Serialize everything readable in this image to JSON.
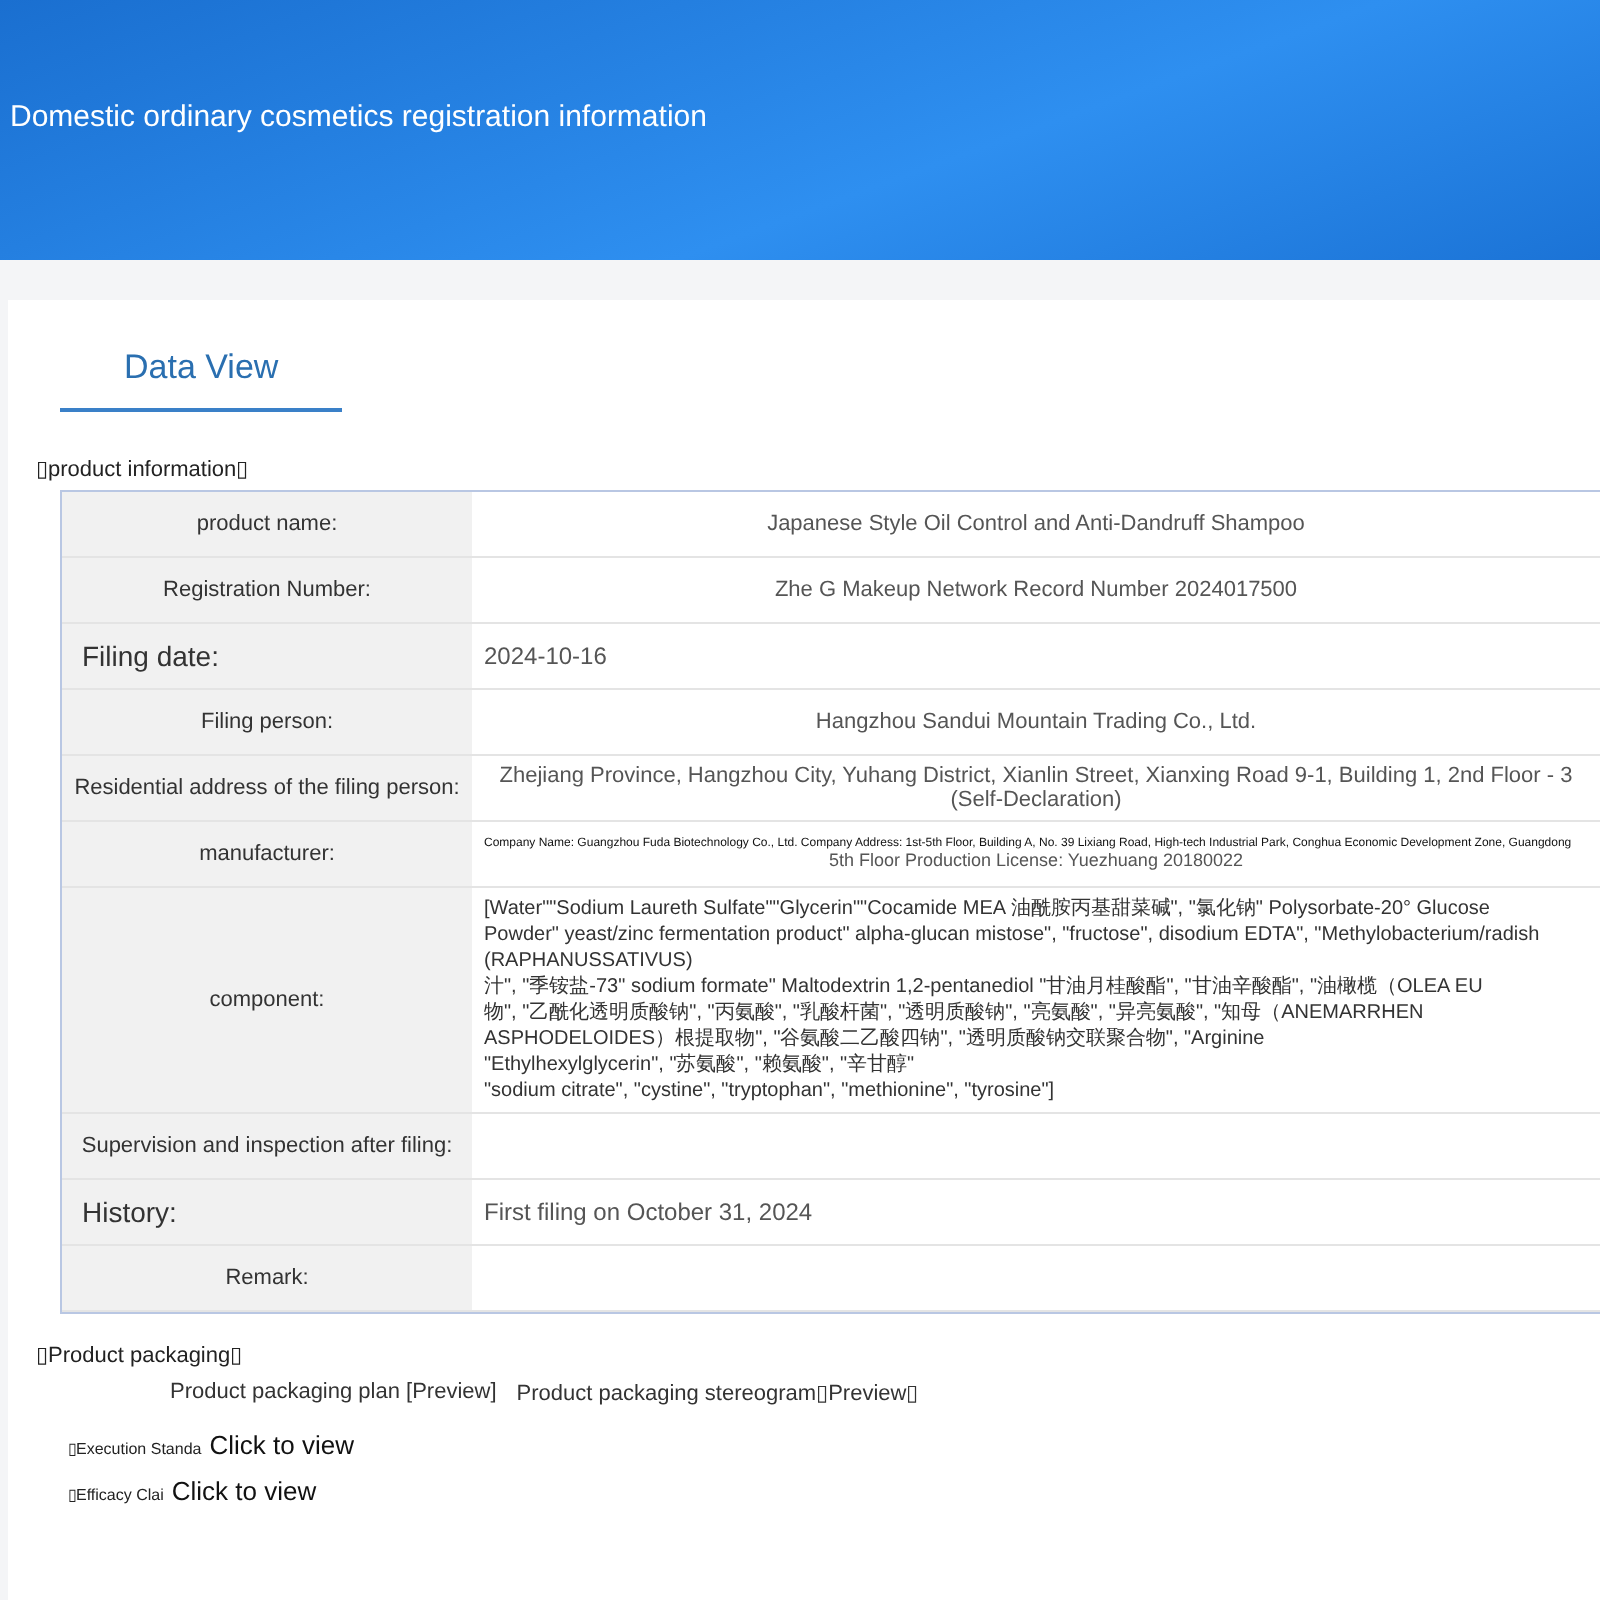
{
  "header": {
    "title": "Domestic ordinary cosmetics registration information"
  },
  "tabs": [
    {
      "label": "Data View",
      "selected": true
    }
  ],
  "product_info": {
    "heading": "▯product information▯",
    "rows": [
      {
        "kind": "text",
        "emphasized": false,
        "label": "product name:",
        "value": "Japanese Style Oil Control and Anti-Dandruff Shampoo"
      },
      {
        "kind": "text",
        "emphasized": false,
        "label": "Registration Number:",
        "value": "Zhe G Makeup Network Record Number 2024017500"
      },
      {
        "kind": "text",
        "emphasized": true,
        "label": "Filing date:",
        "value": "2024-10-16"
      },
      {
        "kind": "text",
        "emphasized": false,
        "label": "Filing person:",
        "value": "Hangzhou Sandui Mountain Trading Co., Ltd."
      },
      {
        "kind": "text",
        "emphasized": false,
        "label": "Residential address of the filing person:",
        "value": "Zhejiang Province, Hangzhou City, Yuhang District, Xianlin Street, Xianxing Road 9-1, Building 1, 2nd Floor - 3 (Self-Declaration)"
      },
      {
        "kind": "manufacturer",
        "emphasized": false,
        "label": "manufacturer:",
        "fine_print": "Company Name: Guangzhou Fuda Biotechnology Co., Ltd. Company Address: 1st-5th Floor, Building A, No. 39 Lixiang Road, High-tech Industrial Park, Conghua Economic Development Zone, Guangdong",
        "value": "5th Floor Production License: Yuezhuang 20180022"
      },
      {
        "kind": "lines",
        "emphasized": false,
        "label": "component:",
        "lines": [
          "[Water\"\"Sodium Laureth Sulfate\"\"Glycerin\"\"Cocamide MEA 油酰胺丙基甜菜碱\", \"氯化钠\" Polysorbate-20° Glucose",
          "Powder\" yeast/zinc fermentation product\" alpha-glucan mistose\", \"fructose\", disodium EDTA\", \"Methylobacterium/radish (RAPHANUSSATIVUS)",
          "汁\", \"季铵盐-73\" sodium formate\" Maltodextrin 1,2-pentanediol \"甘油月桂酸酯\", \"甘油辛酸酯\", \"油橄榄（OLEA EU",
          "物\", \"乙酰化透明质酸钠\", \"丙氨酸\", \"乳酸杆菌\", \"透明质酸钠\", \"亮氨酸\", \"异亮氨酸\", \"知母（ANEMARRHEN",
          "ASPHODELOIDES）根提取物\", \"谷氨酸二乙酸四钠\", \"透明质酸钠交联聚合物\", \"Arginine",
          "\"Ethylhexylglycerin\", \"苏氨酸\", \"赖氨酸\", \"辛甘醇\"",
          "\"sodium citrate\", \"cystine\", \"tryptophan\", \"methionine\", \"tyrosine\"]"
        ]
      },
      {
        "kind": "text",
        "emphasized": false,
        "label": "Supervision and inspection after filing:"
      },
      {
        "kind": "text",
        "emphasized": true,
        "label": "History:",
        "value": "First filing on October 31, 2024"
      },
      {
        "kind": "text",
        "emphasized": false,
        "label": "Remark:"
      }
    ]
  },
  "packaging": {
    "heading": "▯Product packaging▯",
    "links": [
      "Product packaging plan [Preview]",
      "Product packaging stereogram▯Preview▯"
    ]
  },
  "documents": [
    {
      "label": "▯Execution Standa",
      "link": "Click to view"
    },
    {
      "label": "▯Efficacy Clai",
      "link": "Click to view"
    }
  ]
}
